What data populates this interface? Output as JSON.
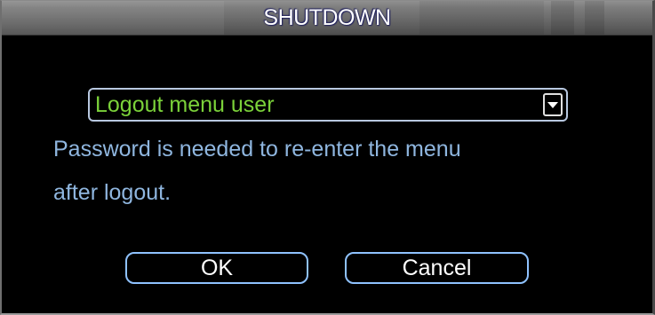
{
  "dialog": {
    "title": "SHUTDOWN",
    "dropdown": {
      "selected": "Logout menu user",
      "arrow_icon": "chevron-down-icon"
    },
    "message_line1": "Password is needed to re-enter the menu",
    "message_line2": "after logout.",
    "ok_label": "OK",
    "cancel_label": "Cancel"
  },
  "colors": {
    "background": "#000000",
    "titlebar": "#7a7a7a",
    "dropdown_text": "#7bd23a",
    "message_text": "#8fb6df",
    "button_border": "#8fc2ff",
    "button_text": "#ffffff"
  }
}
